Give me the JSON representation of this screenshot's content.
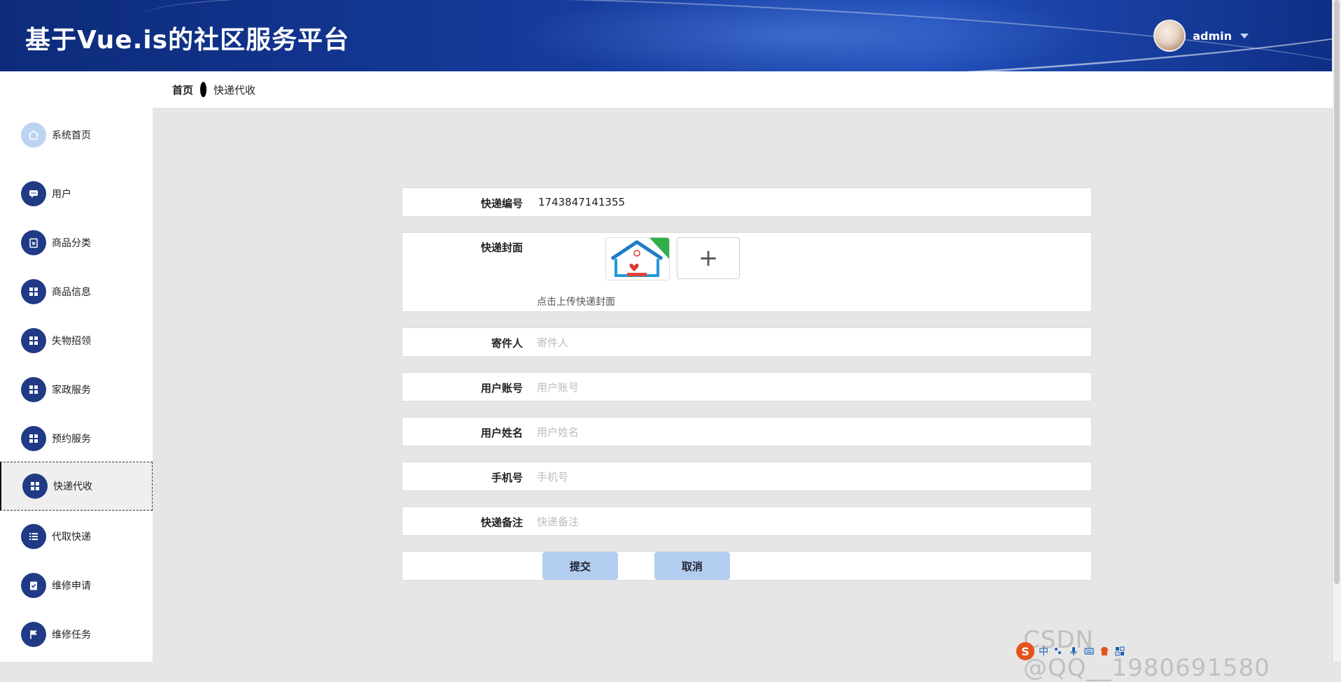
{
  "header": {
    "title": "基于Vue.is的社区服务平台",
    "username": "admin"
  },
  "breadcrumb": {
    "home": "首页",
    "current": "快递代收"
  },
  "sidebar": {
    "items": [
      {
        "label": "系统首页",
        "icon": "home-icon"
      },
      {
        "label": "用户",
        "icon": "chat-icon"
      },
      {
        "label": "商品分类",
        "icon": "clipboard-icon"
      },
      {
        "label": "商品信息",
        "icon": "grid-icon"
      },
      {
        "label": "失物招领",
        "icon": "grid-icon"
      },
      {
        "label": "家政服务",
        "icon": "grid-icon"
      },
      {
        "label": "预约服务",
        "icon": "grid-icon"
      },
      {
        "label": "快递代收",
        "icon": "grid-icon",
        "active": true
      },
      {
        "label": "代取快递",
        "icon": "list-icon"
      },
      {
        "label": "维修申请",
        "icon": "checklist-icon"
      },
      {
        "label": "维修任务",
        "icon": "flag-icon"
      }
    ]
  },
  "form": {
    "express_no": {
      "label": "快递编号",
      "value": "1743847141355"
    },
    "cover": {
      "label": "快递封面",
      "hint": "点击上传快递封面",
      "add": "+"
    },
    "sender": {
      "label": "寄件人",
      "placeholder": "寄件人"
    },
    "user_account": {
      "label": "用户账号",
      "placeholder": "用户账号"
    },
    "user_name": {
      "label": "用户姓名",
      "placeholder": "用户姓名"
    },
    "phone": {
      "label": "手机号",
      "placeholder": "手机号"
    },
    "remark": {
      "label": "快递备注",
      "placeholder": "快递备注"
    },
    "submit": "提交",
    "cancel": "取消"
  },
  "watermark": {
    "text": "CSDN @QQ__1980691580",
    "ime": "中"
  },
  "colors": {
    "header": "#153a9a",
    "sidebar_icon": "#213a86",
    "button": "#b3cdf0"
  }
}
